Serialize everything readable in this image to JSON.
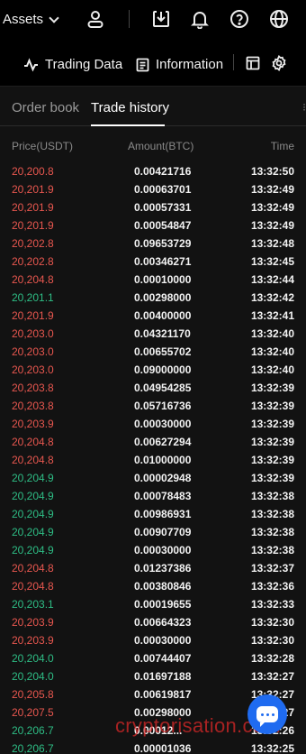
{
  "topbar": {
    "assets_label": "Assets",
    "icons": [
      "user-icon",
      "download-icon",
      "bell-icon",
      "help-icon",
      "globe-icon"
    ]
  },
  "subbar": {
    "trading_data_label": "Trading Data",
    "information_label": "Information",
    "icons": [
      "pulse-icon",
      "document-icon",
      "layout-icon",
      "gear-icon"
    ]
  },
  "tabs": [
    {
      "label": "Order book",
      "active": false
    },
    {
      "label": "Trade history",
      "active": true
    }
  ],
  "columns": {
    "price": "Price(USDT)",
    "amount": "Amount(BTC)",
    "time": "Time"
  },
  "trades": [
    {
      "price": "20,200.8",
      "amount": "0.00421716",
      "time": "13:32:50",
      "side": "sell"
    },
    {
      "price": "20,201.9",
      "amount": "0.00063701",
      "time": "13:32:49",
      "side": "sell"
    },
    {
      "price": "20,201.9",
      "amount": "0.00057331",
      "time": "13:32:49",
      "side": "sell"
    },
    {
      "price": "20,201.9",
      "amount": "0.00054847",
      "time": "13:32:49",
      "side": "sell"
    },
    {
      "price": "20,202.8",
      "amount": "0.09653729",
      "time": "13:32:48",
      "side": "sell"
    },
    {
      "price": "20,202.8",
      "amount": "0.00346271",
      "time": "13:32:45",
      "side": "sell"
    },
    {
      "price": "20,204.8",
      "amount": "0.00010000",
      "time": "13:32:44",
      "side": "sell"
    },
    {
      "price": "20,201.1",
      "amount": "0.00298000",
      "time": "13:32:42",
      "side": "buy"
    },
    {
      "price": "20,201.9",
      "amount": "0.00400000",
      "time": "13:32:41",
      "side": "sell"
    },
    {
      "price": "20,203.0",
      "amount": "0.04321170",
      "time": "13:32:40",
      "side": "sell"
    },
    {
      "price": "20,203.0",
      "amount": "0.00655702",
      "time": "13:32:40",
      "side": "sell"
    },
    {
      "price": "20,203.0",
      "amount": "0.09000000",
      "time": "13:32:40",
      "side": "sell"
    },
    {
      "price": "20,203.8",
      "amount": "0.04954285",
      "time": "13:32:39",
      "side": "sell"
    },
    {
      "price": "20,203.8",
      "amount": "0.05716736",
      "time": "13:32:39",
      "side": "sell"
    },
    {
      "price": "20,203.9",
      "amount": "0.00030000",
      "time": "13:32:39",
      "side": "sell"
    },
    {
      "price": "20,204.8",
      "amount": "0.00627294",
      "time": "13:32:39",
      "side": "sell"
    },
    {
      "price": "20,204.8",
      "amount": "0.01000000",
      "time": "13:32:39",
      "side": "sell"
    },
    {
      "price": "20,204.9",
      "amount": "0.00002948",
      "time": "13:32:39",
      "side": "buy"
    },
    {
      "price": "20,204.9",
      "amount": "0.00078483",
      "time": "13:32:38",
      "side": "buy"
    },
    {
      "price": "20,204.9",
      "amount": "0.00986931",
      "time": "13:32:38",
      "side": "buy"
    },
    {
      "price": "20,204.9",
      "amount": "0.00907709",
      "time": "13:32:38",
      "side": "buy"
    },
    {
      "price": "20,204.9",
      "amount": "0.00030000",
      "time": "13:32:38",
      "side": "buy"
    },
    {
      "price": "20,204.8",
      "amount": "0.01237386",
      "time": "13:32:37",
      "side": "sell"
    },
    {
      "price": "20,204.8",
      "amount": "0.00380846",
      "time": "13:32:36",
      "side": "sell"
    },
    {
      "price": "20,203.1",
      "amount": "0.00019655",
      "time": "13:32:33",
      "side": "buy"
    },
    {
      "price": "20,203.9",
      "amount": "0.00664323",
      "time": "13:32:30",
      "side": "sell"
    },
    {
      "price": "20,203.9",
      "amount": "0.00030000",
      "time": "13:32:30",
      "side": "sell"
    },
    {
      "price": "20,204.0",
      "amount": "0.00744407",
      "time": "13:32:28",
      "side": "buy"
    },
    {
      "price": "20,204.0",
      "amount": "0.01697188",
      "time": "13:32:27",
      "side": "buy"
    },
    {
      "price": "20,205.8",
      "amount": "0.00619817",
      "time": "13:32:27",
      "side": "sell"
    },
    {
      "price": "20,207.5",
      "amount": "0.00298000",
      "time": "13:32:27",
      "side": "sell"
    },
    {
      "price": "20,206.7",
      "amount": "0.00012...",
      "time": "13:32:26",
      "side": "buy"
    },
    {
      "price": "20,206.7",
      "amount": "0.00001036",
      "time": "13:32:25",
      "side": "buy"
    }
  ],
  "colors": {
    "sell": "#e8574f",
    "buy": "#2ebd85",
    "background": "#121212",
    "chat_button": "#1f6bf0"
  },
  "watermark": "cryptorisation.com",
  "chat_icon": "chat-icon"
}
